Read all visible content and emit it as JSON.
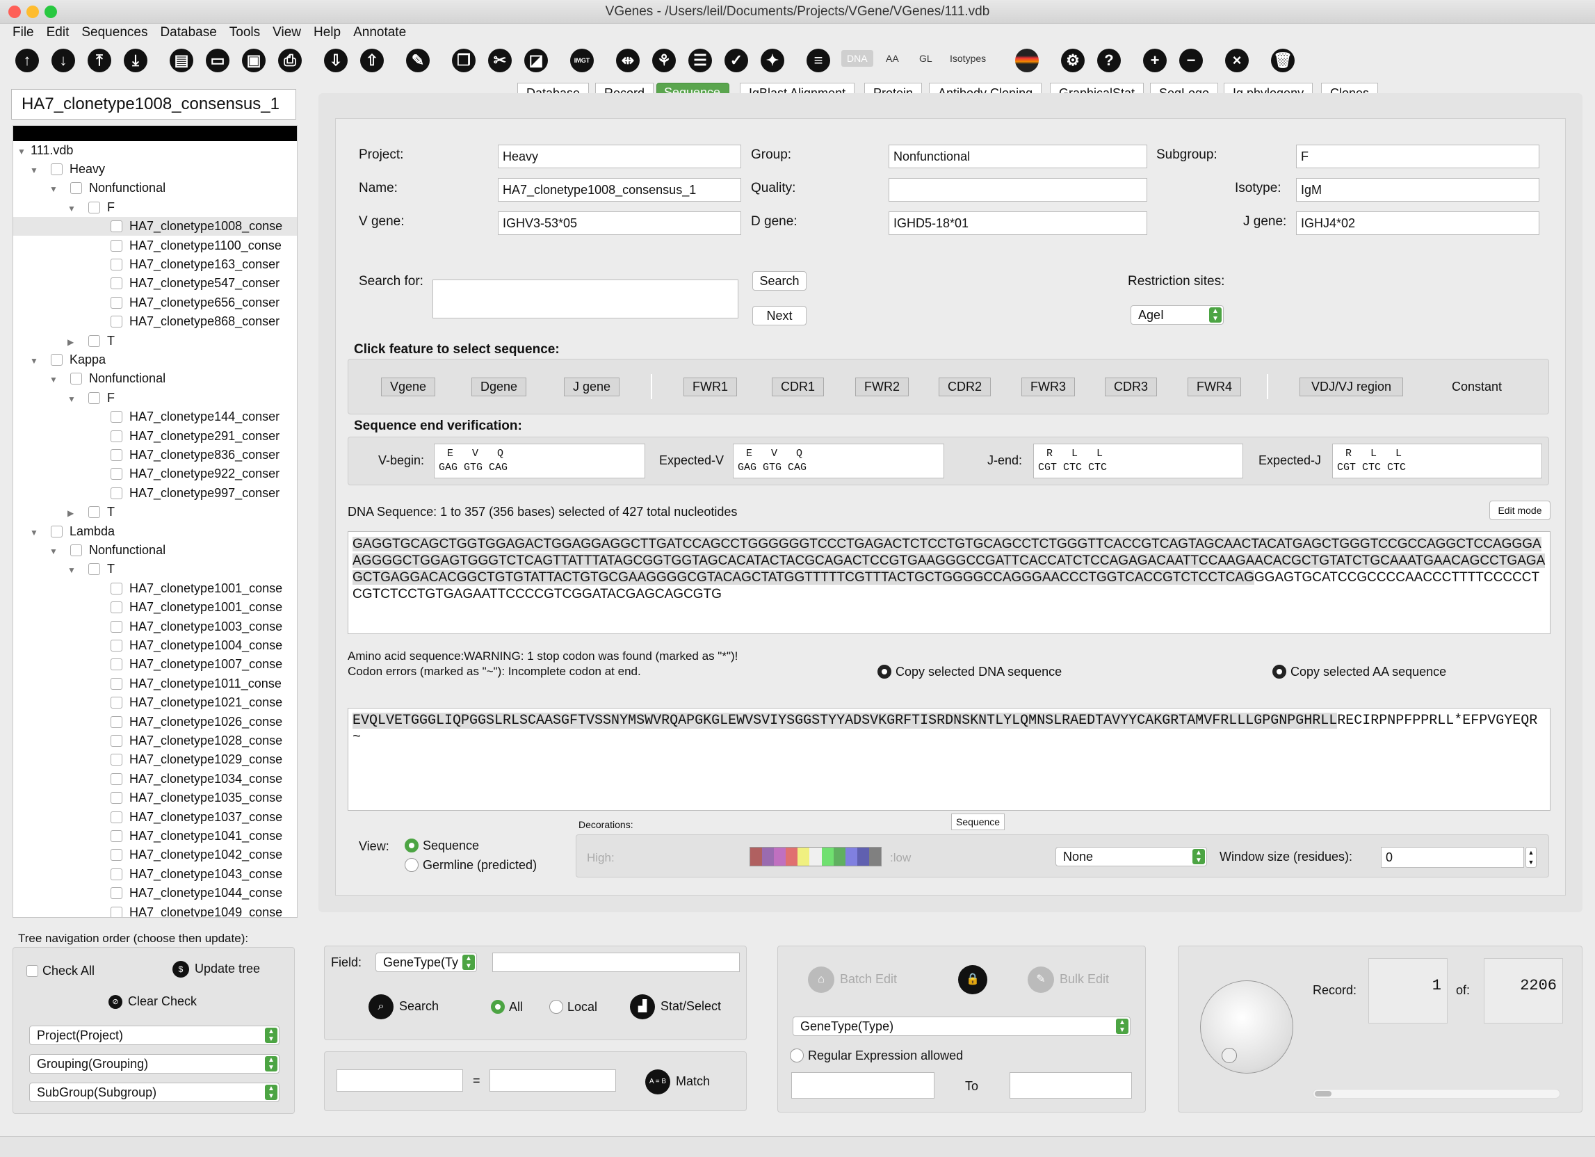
{
  "window": {
    "title": "VGenes - /Users/leil/Documents/Projects/VGene/VGenes/111.vdb"
  },
  "menu": [
    "File",
    "Edit",
    "Sequences",
    "Database",
    "Tools",
    "View",
    "Help",
    "Annotate"
  ],
  "toolbar": {
    "dna": "DNA",
    "aa": "AA",
    "gl": "GL",
    "isotypes": "Isotypes",
    "imgt": "IMGT"
  },
  "record_name": "HA7_clonetype1008_consensus_1",
  "tree": {
    "root": "111.vdb",
    "nodes": [
      {
        "depth": 1,
        "label": "Heavy",
        "tri": "▼"
      },
      {
        "depth": 2,
        "label": "Nonfunctional",
        "tri": "▼"
      },
      {
        "depth": 3,
        "label": "F",
        "tri": "▼"
      },
      {
        "depth": 4,
        "label": "HA7_clonetype1008_conse",
        "sel": true
      },
      {
        "depth": 4,
        "label": "HA7_clonetype1100_conse"
      },
      {
        "depth": 4,
        "label": "HA7_clonetype163_conser"
      },
      {
        "depth": 4,
        "label": "HA7_clonetype547_conser"
      },
      {
        "depth": 4,
        "label": "HA7_clonetype656_conser"
      },
      {
        "depth": 4,
        "label": "HA7_clonetype868_conser"
      },
      {
        "depth": 3,
        "label": "T",
        "tri": "▶"
      },
      {
        "depth": 1,
        "label": "Kappa",
        "tri": "▼"
      },
      {
        "depth": 2,
        "label": "Nonfunctional",
        "tri": "▼"
      },
      {
        "depth": 3,
        "label": "F",
        "tri": "▼"
      },
      {
        "depth": 4,
        "label": "HA7_clonetype144_conser"
      },
      {
        "depth": 4,
        "label": "HA7_clonetype291_conser"
      },
      {
        "depth": 4,
        "label": "HA7_clonetype836_conser"
      },
      {
        "depth": 4,
        "label": "HA7_clonetype922_conser"
      },
      {
        "depth": 4,
        "label": "HA7_clonetype997_conser"
      },
      {
        "depth": 3,
        "label": "T",
        "tri": "▶"
      },
      {
        "depth": 1,
        "label": "Lambda",
        "tri": "▼"
      },
      {
        "depth": 2,
        "label": "Nonfunctional",
        "tri": "▼"
      },
      {
        "depth": 3,
        "label": "T",
        "tri": "▼"
      },
      {
        "depth": 4,
        "label": "HA7_clonetype1001_conse"
      },
      {
        "depth": 4,
        "label": "HA7_clonetype1001_conse"
      },
      {
        "depth": 4,
        "label": "HA7_clonetype1003_conse"
      },
      {
        "depth": 4,
        "label": "HA7_clonetype1004_conse"
      },
      {
        "depth": 4,
        "label": "HA7_clonetype1007_conse"
      },
      {
        "depth": 4,
        "label": "HA7_clonetype1011_conse"
      },
      {
        "depth": 4,
        "label": "HA7_clonetype1021_conse"
      },
      {
        "depth": 4,
        "label": "HA7_clonetype1026_conse"
      },
      {
        "depth": 4,
        "label": "HA7_clonetype1028_conse"
      },
      {
        "depth": 4,
        "label": "HA7_clonetype1029_conse"
      },
      {
        "depth": 4,
        "label": "HA7_clonetype1034_conse"
      },
      {
        "depth": 4,
        "label": "HA7_clonetype1035_conse"
      },
      {
        "depth": 4,
        "label": "HA7_clonetype1037_conse"
      },
      {
        "depth": 4,
        "label": "HA7_clonetype1041_conse"
      },
      {
        "depth": 4,
        "label": "HA7_clonetype1042_conse"
      },
      {
        "depth": 4,
        "label": "HA7_clonetype1043_conse"
      },
      {
        "depth": 4,
        "label": "HA7_clonetype1044_conse"
      },
      {
        "depth": 4,
        "label": "HA7_clonetype1049_conse"
      }
    ]
  },
  "tabs": [
    "Database",
    "Record",
    "Sequence",
    "IgBlast Alignment",
    "Protein",
    "Antibody Cloning",
    "GraphicalStat",
    "SeqLogo",
    "Ig phylogeny",
    "Clones"
  ],
  "fields": {
    "project_label": "Project:",
    "project": "Heavy",
    "group_label": "Group:",
    "group": "Nonfunctional",
    "subgroup_label": "Subgroup:",
    "subgroup": "F",
    "name_label": "Name:",
    "name": "HA7_clonetype1008_consensus_1",
    "quality_label": "Quality:",
    "quality": "",
    "isotype_label": "Isotype:",
    "isotype": "IgM",
    "vgene_label": "V gene:",
    "vgene": "IGHV3-53*05",
    "dgene_label": "D gene:",
    "dgene": "IGHD5-18*01",
    "jgene_label": "J gene:",
    "jgene": "IGHJ4*02"
  },
  "search": {
    "label": "Search for:",
    "button": "Search",
    "next": "Next",
    "restriction_label": "Restriction sites:",
    "restriction": "AgeI"
  },
  "features": {
    "title": "Click feature to select sequence:",
    "items": [
      "Vgene",
      "Dgene",
      "J gene",
      "FWR1",
      "CDR1",
      "FWR2",
      "CDR2",
      "FWR3",
      "CDR3",
      "FWR4",
      "VDJ/VJ region"
    ],
    "constant": "Constant"
  },
  "verify": {
    "title": "Sequence end verification:",
    "vbegin_label": "V-begin:",
    "vbegin_aa": "E   V   Q",
    "vbegin_nt": "GAG GTG CAG",
    "expv_label": "Expected-V",
    "expv_aa": "E   V   Q",
    "expv_nt": "GAG GTG CAG",
    "jend_label": "J-end:",
    "jend_aa": "R   L   L",
    "jend_nt": "CGT CTC CTC",
    "expj_label": "Expected-J",
    "expj_aa": "R   L   L",
    "expj_nt": "CGT CTC CTC"
  },
  "dna": {
    "info": "DNA Sequence: 1 to 357 (356 bases)  selected of 427 total nucleotides",
    "edit_mode": "Edit mode",
    "sel": "GAGGTGCAGCTGGTGGAGACTGGAGGAGGCTTGATCCAGCCTGGGGGGTCCCTGAGACTCTCCTGTGCAGCCTCTGGGTTCACCGTCAGTAGCAACTACATGAGCTGGGTCCGCCAGGCTCCAGGGAAGGGGCTGGAGTGGGTCTCAGTTATTTATAGCGGTGGTAGCACATACTACGCAGACTCCGTGAAGGGCCGATTCACCATCTCCAGAGACAATTCCAAGAACACGCTGTATCTGCAAATGAACAGCCTGAGAGCTGAGGACACGGCTGTGTATTACTGTGCGAAGGGGCGTACAGCTATGGTTTTTCGTTTACTGCTGGGGCCAGGGAACCCTGGTCACCGTCTCCTCAG",
    "rest": "GGAGTGCATCCGCCCCAACCCTTTTCCCCCTCGTCTCCTGTGAGAATTCCCCGTCGGATACGAGCAGCGTG"
  },
  "aa": {
    "warning1": "Amino acid sequence:WARNING: 1 stop codon was found (marked as \"*\")!",
    "warning2": "Codon errors (marked as \"~\"): Incomplete codon at end.",
    "copy_dna": "Copy selected DNA sequence",
    "copy_aa": "Copy selected AA sequence",
    "sel": "EVQLVETGGGLIQPGGSLRLSCAASGFTVSSNYMSWVRQAPGKGLEWVSVIYSGGSTYYADSVKGRFTISRDNSKNTLYLQMNSLRAEDTAVYYCAKGRTAMVFRLLLGPGNPGHRLL",
    "rest": "RECIRPNPFPPRLL*EFPVGYEQR~"
  },
  "view": {
    "label": "View:",
    "sequence": "Sequence",
    "germline": "Germline (predicted)",
    "decorations": "Decorations:",
    "tooltip": "Sequence",
    "high": "High:",
    "low": ":low",
    "deco_select": "None",
    "window_label": "Window size (residues):",
    "window": "0"
  },
  "colors": {
    "accent": "#4ca443",
    "tab_selected": "#5aa54e",
    "scale": [
      "#b06060",
      "#9a6bb0",
      "#c070c0",
      "#e07070",
      "#f0f080",
      "#f0f0f0",
      "#70e070",
      "#60b060",
      "#8080e0",
      "#6060b0",
      "#808080"
    ]
  },
  "nav": {
    "title": "Tree navigation order (choose then update):",
    "check_all": "Check All",
    "update_tree": "Update tree",
    "clear_check": "Clear Check",
    "sel1": "Project(Project)",
    "sel2": "Grouping(Grouping)",
    "sel3": "SubGroup(Subgroup)"
  },
  "searchpanel": {
    "field_label": "Field:",
    "field": "GeneType(Ty",
    "search": "Search",
    "all": "All",
    "local": "Local",
    "stat": "Stat/Select",
    "eq": "=",
    "match": "Match",
    "match_icon": "A = B"
  },
  "batch": {
    "batch_edit": "Batch Edit",
    "bulk_edit": "Bulk Edit",
    "select": "GeneType(Type)",
    "regex": "Regular Expression allowed",
    "to": "To"
  },
  "record": {
    "label": "Record:",
    "value": "1",
    "of_label": "of:",
    "total": "2206"
  }
}
